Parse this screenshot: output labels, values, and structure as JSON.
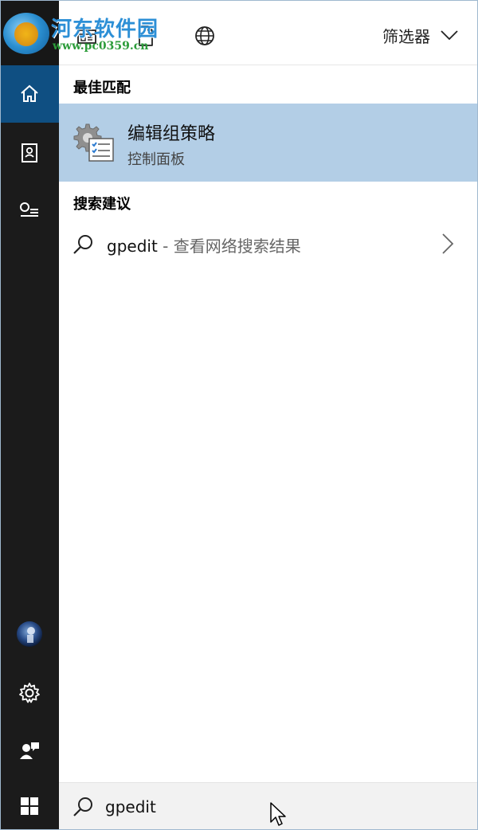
{
  "watermark": {
    "name": "河东软件园",
    "url": "www.pc0359.cn"
  },
  "toolbar": {
    "filter_label": "筛选器"
  },
  "sections": {
    "best_match": "最佳匹配",
    "suggestions": "搜索建议"
  },
  "best_result": {
    "title": "编辑组策略",
    "subtitle": "控制面板"
  },
  "suggestion": {
    "query": "gpedit",
    "detail": "- 查看网络搜索结果"
  },
  "search": {
    "value": "gpedit"
  },
  "colors": {
    "accent": "#0f4f82",
    "highlight": "#b3cee6",
    "rail": "#1b1b1b"
  }
}
